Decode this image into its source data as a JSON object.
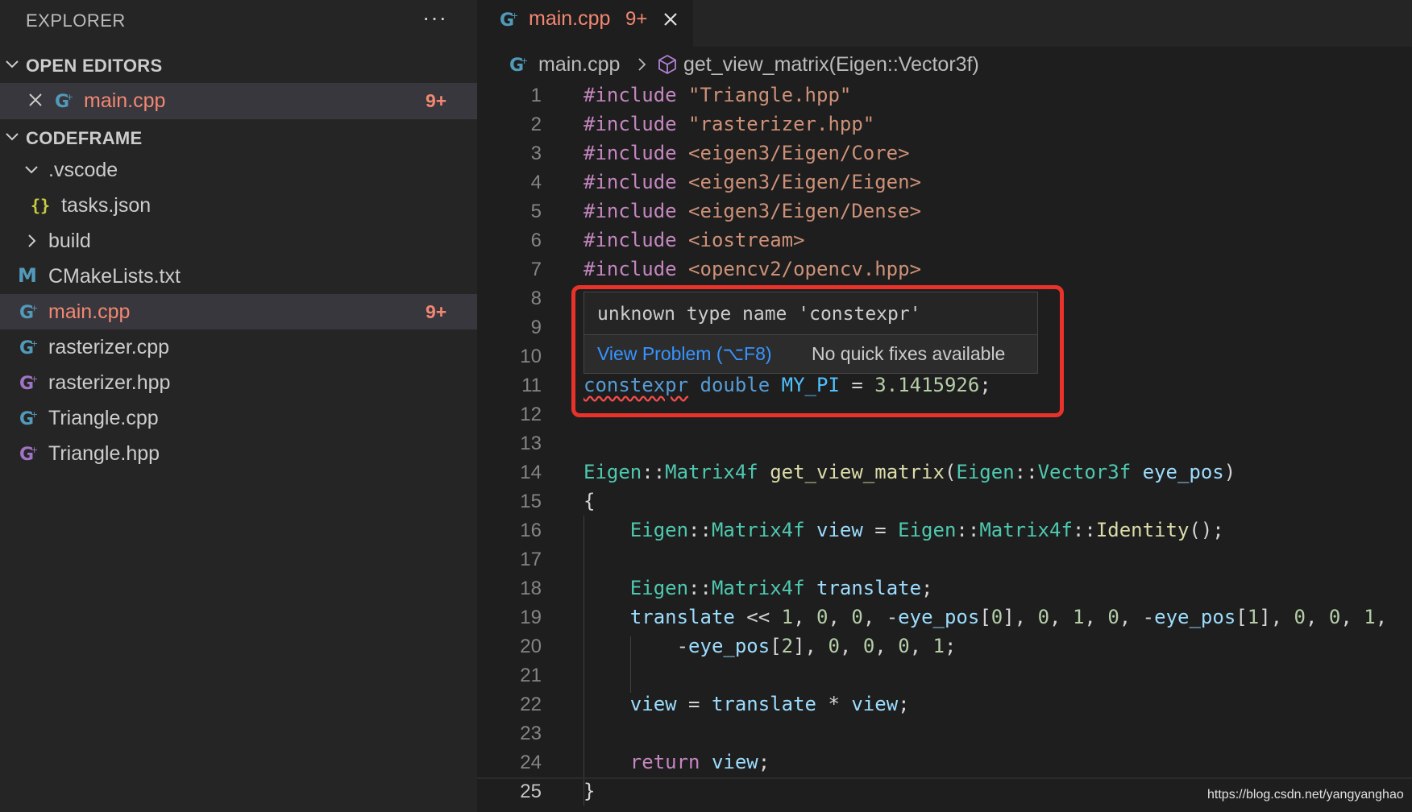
{
  "sidebar": {
    "title": "EXPLORER",
    "more_label": "···",
    "open_editors": {
      "header": "OPEN EDITORS",
      "items": [
        {
          "name": "main.cpp",
          "badge": "9+"
        }
      ]
    },
    "workspace": {
      "header": "CODEFRAME",
      "tree": [
        {
          "name": ".vscode",
          "kind": "folder-open",
          "icon": "chevron-down-icon"
        },
        {
          "name": "tasks.json",
          "kind": "file",
          "icon": "json-icon"
        },
        {
          "name": "build",
          "kind": "folder",
          "icon": "chevron-right-icon"
        },
        {
          "name": "CMakeLists.txt",
          "kind": "file",
          "icon": "cmake-icon"
        },
        {
          "name": "main.cpp",
          "kind": "file",
          "icon": "cpp-icon",
          "badge": "9+",
          "active": true
        },
        {
          "name": "rasterizer.cpp",
          "kind": "file",
          "icon": "cpp-icon"
        },
        {
          "name": "rasterizer.hpp",
          "kind": "file",
          "icon": "hpp-icon"
        },
        {
          "name": "Triangle.cpp",
          "kind": "file",
          "icon": "cpp-icon"
        },
        {
          "name": "Triangle.hpp",
          "kind": "file",
          "icon": "hpp-icon"
        }
      ]
    }
  },
  "editor": {
    "tab": {
      "label": "main.cpp",
      "badge": "9+"
    },
    "breadcrumb": {
      "file": "main.cpp",
      "symbol": "get_view_matrix(Eigen::Vector3f)"
    },
    "current_line": 25,
    "lines": [
      {
        "n": "1",
        "tokens": [
          [
            "kw",
            "#include"
          ],
          [
            "txt",
            " "
          ],
          [
            "str",
            "\"Triangle.hpp\""
          ]
        ]
      },
      {
        "n": "2",
        "tokens": [
          [
            "kw",
            "#include"
          ],
          [
            "txt",
            " "
          ],
          [
            "str",
            "\"rasterizer.hpp\""
          ]
        ]
      },
      {
        "n": "3",
        "tokens": [
          [
            "kw",
            "#include"
          ],
          [
            "txt",
            " "
          ],
          [
            "str",
            "<eigen3/Eigen/Core>"
          ]
        ]
      },
      {
        "n": "4",
        "tokens": [
          [
            "kw",
            "#include"
          ],
          [
            "txt",
            " "
          ],
          [
            "str",
            "<eigen3/Eigen/Eigen>"
          ]
        ]
      },
      {
        "n": "5",
        "tokens": [
          [
            "kw",
            "#include"
          ],
          [
            "txt",
            " "
          ],
          [
            "str",
            "<eigen3/Eigen/Dense>"
          ]
        ]
      },
      {
        "n": "6",
        "tokens": [
          [
            "kw",
            "#include"
          ],
          [
            "txt",
            " "
          ],
          [
            "str",
            "<iostream>"
          ]
        ]
      },
      {
        "n": "7",
        "tokens": [
          [
            "kw",
            "#include"
          ],
          [
            "txt",
            " "
          ],
          [
            "str",
            "<opencv2/opencv.hpp>"
          ]
        ]
      },
      {
        "n": "8",
        "tokens": []
      },
      {
        "n": "9",
        "tokens": []
      },
      {
        "n": "10",
        "tokens": []
      },
      {
        "n": "11",
        "tokens": [
          [
            "squiggle",
            "constexpr"
          ],
          [
            "txt",
            " "
          ],
          [
            "blue",
            "double"
          ],
          [
            "txt",
            " "
          ],
          [
            "const",
            "MY_PI"
          ],
          [
            "txt",
            " = "
          ],
          [
            "num",
            "3.1415926"
          ],
          [
            "txt",
            ";"
          ]
        ]
      },
      {
        "n": "12",
        "tokens": []
      },
      {
        "n": "13",
        "tokens": []
      },
      {
        "n": "14",
        "tokens": [
          [
            "ty",
            "Eigen"
          ],
          [
            "txt",
            "::"
          ],
          [
            "ty",
            "Matrix4f"
          ],
          [
            "txt",
            " "
          ],
          [
            "fn",
            "get_view_matrix"
          ],
          [
            "txt",
            "("
          ],
          [
            "ty",
            "Eigen"
          ],
          [
            "txt",
            "::"
          ],
          [
            "ty",
            "Vector3f"
          ],
          [
            "txt",
            " "
          ],
          [
            "var",
            "eye_pos"
          ],
          [
            "txt",
            ")"
          ]
        ]
      },
      {
        "n": "15",
        "tokens": [
          [
            "txt",
            "{"
          ]
        ]
      },
      {
        "n": "16",
        "tokens": [
          [
            "txt",
            "    "
          ],
          [
            "ty",
            "Eigen"
          ],
          [
            "txt",
            "::"
          ],
          [
            "ty",
            "Matrix4f"
          ],
          [
            "txt",
            " "
          ],
          [
            "var",
            "view"
          ],
          [
            "txt",
            " = "
          ],
          [
            "ty",
            "Eigen"
          ],
          [
            "txt",
            "::"
          ],
          [
            "ty",
            "Matrix4f"
          ],
          [
            "txt",
            "::"
          ],
          [
            "fn",
            "Identity"
          ],
          [
            "txt",
            "();"
          ]
        ]
      },
      {
        "n": "17",
        "tokens": []
      },
      {
        "n": "18",
        "tokens": [
          [
            "txt",
            "    "
          ],
          [
            "ty",
            "Eigen"
          ],
          [
            "txt",
            "::"
          ],
          [
            "ty",
            "Matrix4f"
          ],
          [
            "txt",
            " "
          ],
          [
            "var",
            "translate"
          ],
          [
            "txt",
            ";"
          ]
        ]
      },
      {
        "n": "19",
        "tokens": [
          [
            "txt",
            "    "
          ],
          [
            "var",
            "translate"
          ],
          [
            "txt",
            " << "
          ],
          [
            "num",
            "1"
          ],
          [
            "txt",
            ", "
          ],
          [
            "num",
            "0"
          ],
          [
            "txt",
            ", "
          ],
          [
            "num",
            "0"
          ],
          [
            "txt",
            ", -"
          ],
          [
            "var",
            "eye_pos"
          ],
          [
            "txt",
            "["
          ],
          [
            "num",
            "0"
          ],
          [
            "txt",
            "], "
          ],
          [
            "num",
            "0"
          ],
          [
            "txt",
            ", "
          ],
          [
            "num",
            "1"
          ],
          [
            "txt",
            ", "
          ],
          [
            "num",
            "0"
          ],
          [
            "txt",
            ", -"
          ],
          [
            "var",
            "eye_pos"
          ],
          [
            "txt",
            "["
          ],
          [
            "num",
            "1"
          ],
          [
            "txt",
            "], "
          ],
          [
            "num",
            "0"
          ],
          [
            "txt",
            ", "
          ],
          [
            "num",
            "0"
          ],
          [
            "txt",
            ", "
          ],
          [
            "num",
            "1"
          ],
          [
            "txt",
            ","
          ]
        ]
      },
      {
        "n": "20",
        "tokens": [
          [
            "txt",
            "        -"
          ],
          [
            "var",
            "eye_pos"
          ],
          [
            "txt",
            "["
          ],
          [
            "num",
            "2"
          ],
          [
            "txt",
            "], "
          ],
          [
            "num",
            "0"
          ],
          [
            "txt",
            ", "
          ],
          [
            "num",
            "0"
          ],
          [
            "txt",
            ", "
          ],
          [
            "num",
            "0"
          ],
          [
            "txt",
            ", "
          ],
          [
            "num",
            "1"
          ],
          [
            "txt",
            ";"
          ]
        ]
      },
      {
        "n": "21",
        "tokens": []
      },
      {
        "n": "22",
        "tokens": [
          [
            "txt",
            "    "
          ],
          [
            "var",
            "view"
          ],
          [
            "txt",
            " = "
          ],
          [
            "var",
            "translate"
          ],
          [
            "txt",
            " * "
          ],
          [
            "var",
            "view"
          ],
          [
            "txt",
            ";"
          ]
        ]
      },
      {
        "n": "23",
        "tokens": []
      },
      {
        "n": "24",
        "tokens": [
          [
            "txt",
            "    "
          ],
          [
            "ret",
            "return"
          ],
          [
            "txt",
            " "
          ],
          [
            "var",
            "view"
          ],
          [
            "txt",
            ";"
          ]
        ]
      },
      {
        "n": "25",
        "tokens": [
          [
            "txt",
            "}"
          ]
        ]
      }
    ]
  },
  "hover": {
    "message": "unknown type name 'constexpr'",
    "action_label": "View Problem (⌥F8)",
    "status_text": "No quick fixes available"
  },
  "watermark": "https://blog.csdn.net/yangyanghao",
  "colors": {
    "modified_file": "#f48771",
    "error_highlight": "#e8322a",
    "link": "#3794ff"
  }
}
